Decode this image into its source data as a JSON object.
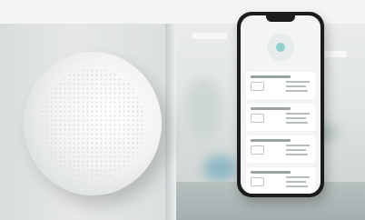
{
  "scene": {
    "subject": "wall-mounted-air-sensor",
    "secondary": "smartphone-app-mockup"
  },
  "colors": {
    "wall": "#e6e8e8",
    "device": "#f2f3f3",
    "phone_frame": "#1b1c1e",
    "app_accent": "#8fd1c8"
  },
  "phone": {
    "cards": [
      {
        "name": "card-1"
      },
      {
        "name": "card-2"
      },
      {
        "name": "card-3"
      },
      {
        "name": "card-4"
      }
    ]
  }
}
